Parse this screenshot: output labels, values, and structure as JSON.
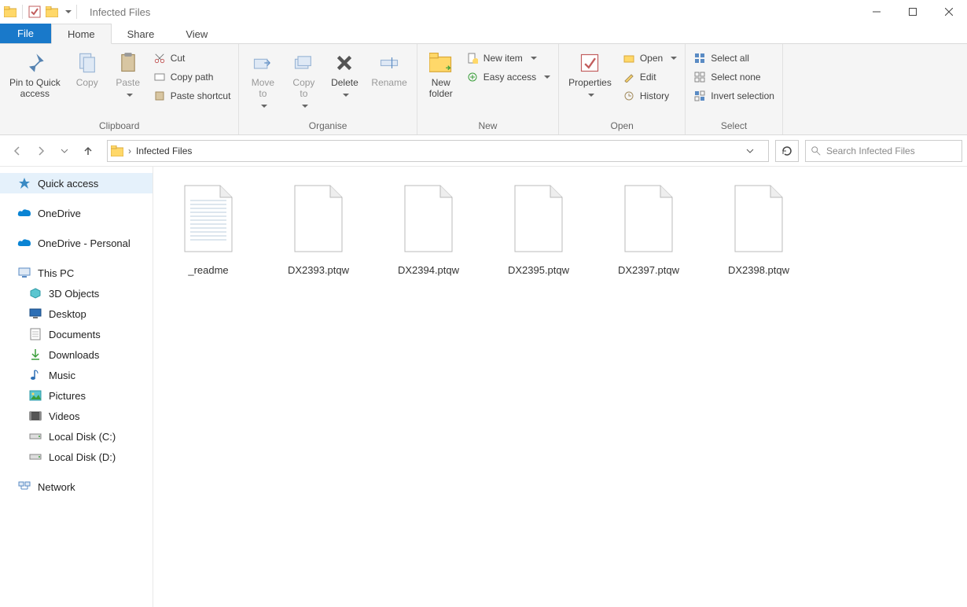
{
  "title": "Infected Files",
  "tabs": {
    "file": "File",
    "home": "Home",
    "share": "Share",
    "view": "View"
  },
  "ribbon": {
    "clipboard": {
      "pin": "Pin to Quick\naccess",
      "copy": "Copy",
      "paste": "Paste",
      "cut": "Cut",
      "copypath": "Copy path",
      "pasteshortcut": "Paste shortcut",
      "label": "Clipboard"
    },
    "organise": {
      "moveto": "Move\nto",
      "copyto": "Copy\nto",
      "delete": "Delete",
      "rename": "Rename",
      "label": "Organise"
    },
    "new": {
      "newfolder": "New\nfolder",
      "newitem": "New item",
      "easyaccess": "Easy access",
      "label": "New"
    },
    "open": {
      "properties": "Properties",
      "open": "Open",
      "edit": "Edit",
      "history": "History",
      "label": "Open"
    },
    "select": {
      "selectall": "Select all",
      "selectnone": "Select none",
      "invert": "Invert selection",
      "label": "Select"
    }
  },
  "breadcrumb": {
    "current": "Infected Files"
  },
  "search_placeholder": "Search Infected Files",
  "nav": {
    "quick": "Quick access",
    "onedrive": "OneDrive",
    "onedrive_personal": "OneDrive - Personal",
    "thispc": "This PC",
    "objects3d": "3D Objects",
    "desktop": "Desktop",
    "documents": "Documents",
    "downloads": "Downloads",
    "music": "Music",
    "pictures": "Pictures",
    "videos": "Videos",
    "diskc": "Local Disk (C:)",
    "diskd": "Local Disk (D:)",
    "network": "Network"
  },
  "files": [
    {
      "name": "_readme",
      "type": "text"
    },
    {
      "name": "DX2393.ptqw",
      "type": "blank"
    },
    {
      "name": "DX2394.ptqw",
      "type": "blank"
    },
    {
      "name": "DX2395.ptqw",
      "type": "blank"
    },
    {
      "name": "DX2397.ptqw",
      "type": "blank"
    },
    {
      "name": "DX2398.ptqw",
      "type": "blank"
    }
  ]
}
